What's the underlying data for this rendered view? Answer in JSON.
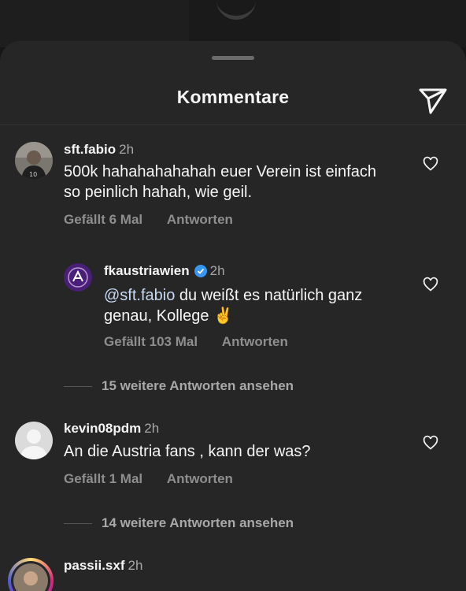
{
  "header": {
    "title": "Kommentare",
    "share_icon": "send-icon"
  },
  "comments": [
    {
      "username": "sft.fabio",
      "time": "2h",
      "text": "500k hahahahahahah euer Verein ist einfach so peinlich hahah, wie geil.",
      "likes": "Gefällt 6 Mal",
      "reply": "Antworten",
      "replies": [
        {
          "username": "fkaustriawien",
          "verified": true,
          "time": "2h",
          "mention": "@sft.fabio",
          "text": " du weißt es natürlich ganz genau, Kollege ✌️",
          "likes": "Gefällt 103 Mal",
          "reply": "Antworten"
        }
      ],
      "view_more": "15 weitere Antworten ansehen"
    },
    {
      "username": "kevin08pdm",
      "time": "2h",
      "text": "An die Austria fans , kann der was?",
      "likes": "Gefällt 1 Mal",
      "reply": "Antworten",
      "view_more": "14 weitere Antworten ansehen"
    },
    {
      "username": "passii.sxf",
      "time": "2h"
    }
  ],
  "colors": {
    "sheet": "#262626",
    "text": "#f5f5f5",
    "muted": "#8e8e8e",
    "verified": "#3897f0",
    "austria_violet": "#5b2a86"
  }
}
